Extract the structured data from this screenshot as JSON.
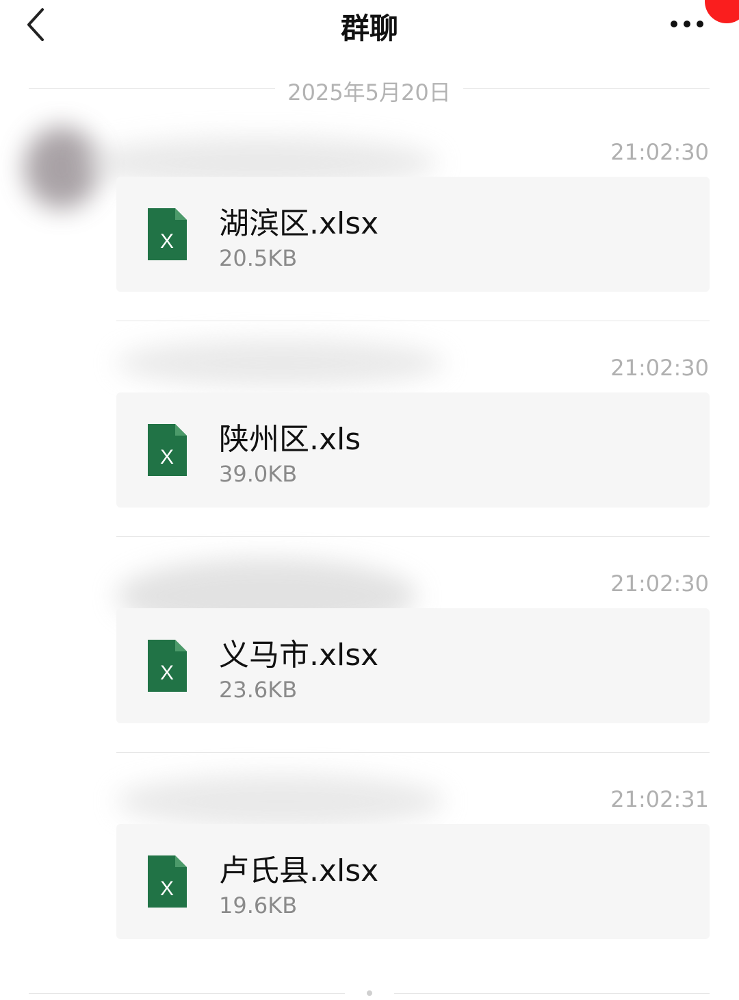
{
  "header": {
    "title": "群聊",
    "back_icon": "chevron-left-icon",
    "more_icon": "more-dots-icon",
    "badge_color": "#fa1e1e"
  },
  "date_divider": "2025年5月20日",
  "messages": [
    {
      "time": "21:02:30",
      "file_name": "湖滨区.xlsx",
      "file_size": "20.5KB",
      "icon": "excel-file-icon",
      "icon_letter": "X"
    },
    {
      "time": "21:02:30",
      "file_name": "陕州区.xls",
      "file_size": "39.0KB",
      "icon": "excel-file-icon",
      "icon_letter": "X"
    },
    {
      "time": "21:02:30",
      "file_name": "义马市.xlsx",
      "file_size": "23.6KB",
      "icon": "excel-file-icon",
      "icon_letter": "X"
    },
    {
      "time": "21:02:31",
      "file_name": "卢氏县.xlsx",
      "file_size": "19.6KB",
      "icon": "excel-file-icon",
      "icon_letter": "X"
    }
  ],
  "colors": {
    "excel_green": "#217346",
    "card_bg": "#f6f6f6",
    "meta_text": "#b0b0b0"
  }
}
